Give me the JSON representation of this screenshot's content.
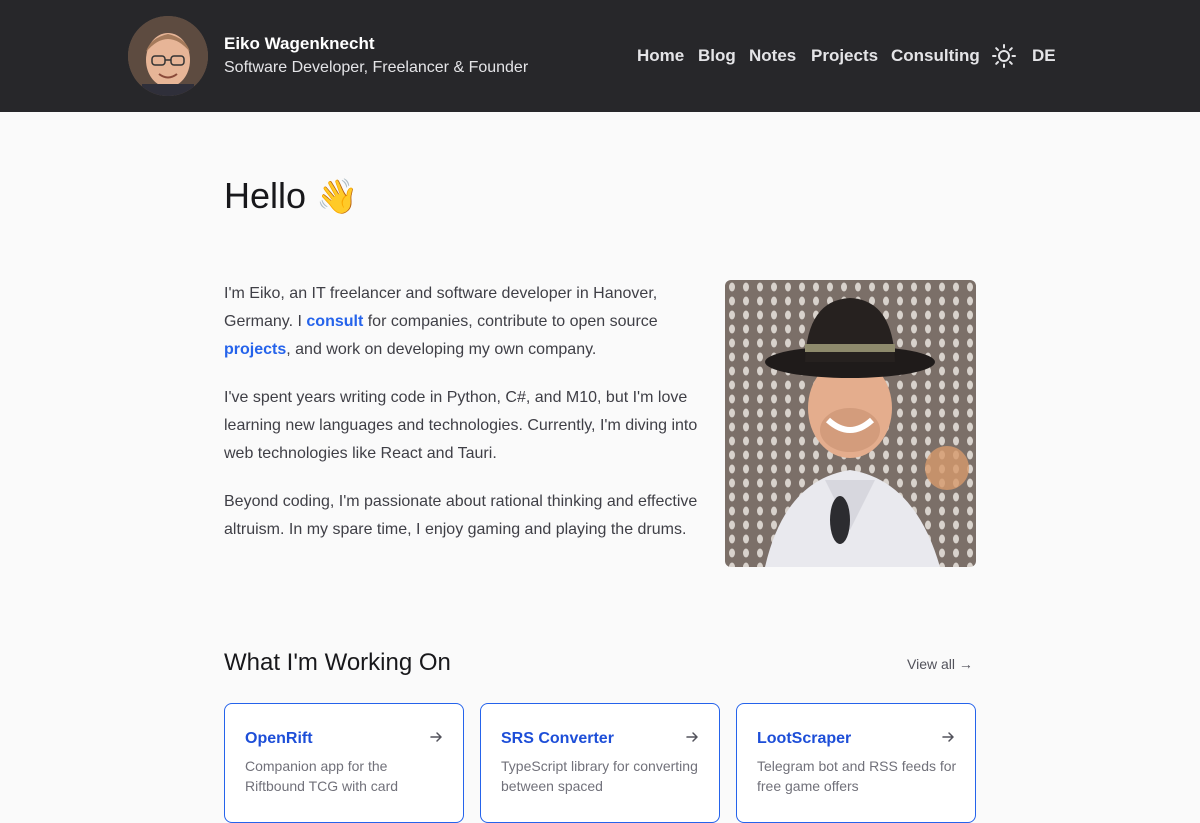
{
  "header": {
    "name": "Eiko Wagenknecht",
    "tagline": "Software Developer, Freelancer & Founder",
    "nav": [
      "Home",
      "Blog",
      "Notes",
      "Projects",
      "Consulting"
    ],
    "language": "DE",
    "theme_icon": "sun-icon"
  },
  "hero": {
    "greeting": "Hello",
    "emoji": "👋"
  },
  "bio": {
    "p1_a": "I'm Eiko, an IT freelancer and software developer in Hanover, Germany. I ",
    "p1_link1": "consult",
    "p1_b": " for companies, contribute to open source ",
    "p1_link2": "projects",
    "p1_c": ", and work on developing my own company.",
    "p2": "I've spent years writing code in Python, C#, and M10, but I'm love learning new languages and technologies. Currently, I'm diving into web technologies like React and Tauri.",
    "p3": "Beyond coding, I'm passionate about rational thinking and effective altruism. In my spare time, I enjoy gaming and playing the drums."
  },
  "working_on": {
    "title": "What I'm Working On",
    "view_all": "View all →",
    "cards": [
      {
        "title": "OpenRift",
        "desc": "Companion app for the Riftbound TCG with card"
      },
      {
        "title": "SRS Converter",
        "desc": "TypeScript library for converting between spaced"
      },
      {
        "title": "LootScraper",
        "desc": "Telegram bot and RSS feeds for free game offers"
      }
    ]
  }
}
